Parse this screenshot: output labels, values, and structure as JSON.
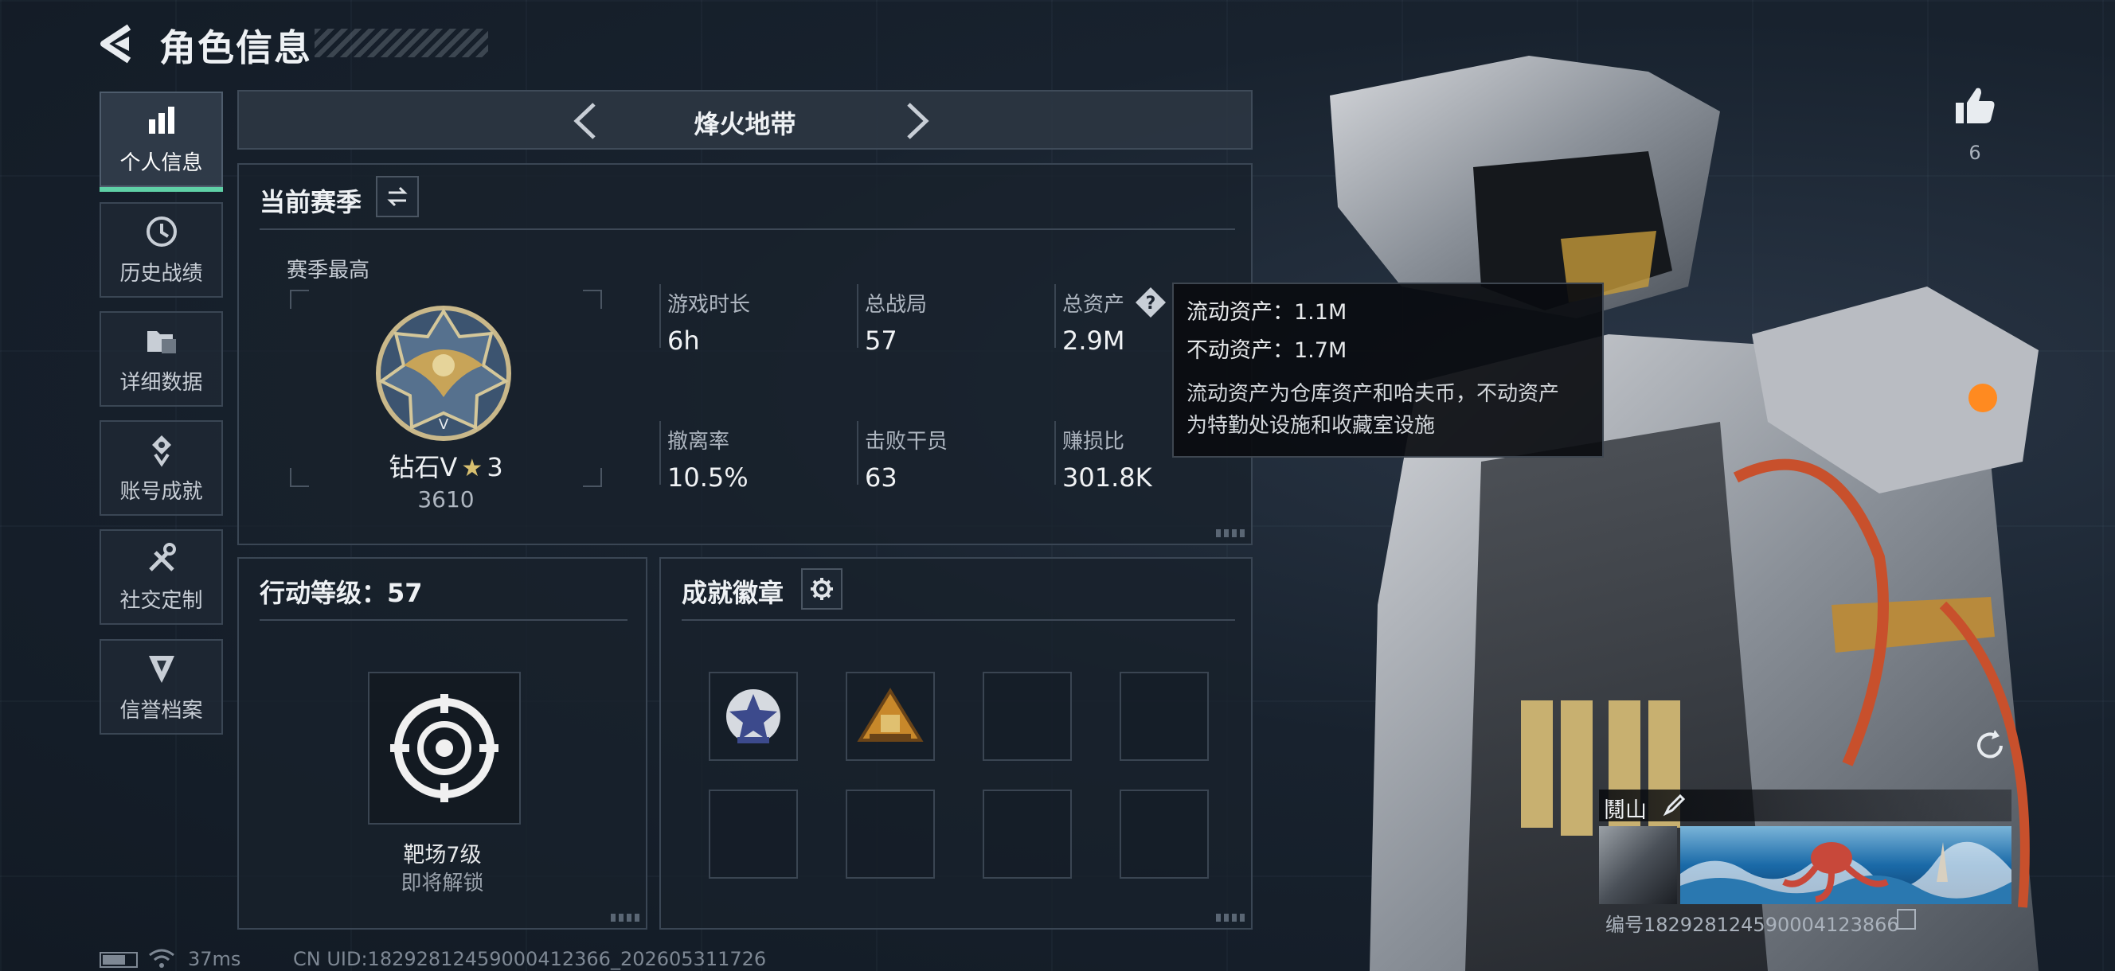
{
  "header": {
    "title": "角色信息"
  },
  "sidebar": {
    "items": [
      {
        "label": "个人信息",
        "icon": "bar-chart-icon",
        "active": true
      },
      {
        "label": "历史战绩",
        "icon": "clock-history-icon"
      },
      {
        "label": "详细数据",
        "icon": "folder-data-icon"
      },
      {
        "label": "账号成就",
        "icon": "achievement-medal-icon"
      },
      {
        "label": "社交定制",
        "icon": "tools-icon"
      },
      {
        "label": "信誉档案",
        "icon": "credit-shield-icon"
      }
    ]
  },
  "mode": {
    "title": "烽火地带"
  },
  "season": {
    "title": "当前赛季",
    "best_label": "赛季最高",
    "rank": "钻石Ⅴ",
    "stars": "3",
    "score": "3610",
    "stats": [
      {
        "label": "游戏时长",
        "value": "6h"
      },
      {
        "label": "总战局",
        "value": "57"
      },
      {
        "label": "总资产",
        "value": "2.9M"
      },
      {
        "label": "撤离率",
        "value": "10.5%"
      },
      {
        "label": "击败干员",
        "value": "63"
      },
      {
        "label": "赚损比",
        "value": "301.8K"
      }
    ]
  },
  "tooltip": {
    "liquid": "流动资产：1.1M",
    "fixed": "不动资产：1.7M",
    "desc_line1": "流动资产为仓库资产和哈夫币，不动资产",
    "desc_line2": "为特勤处设施和收藏室设施"
  },
  "action_level": {
    "title": "行动等级：57",
    "unlock_name": "靶场7级",
    "unlock_status": "即将解锁"
  },
  "achievements": {
    "title": "成就徽章"
  },
  "likes": {
    "count": "6"
  },
  "player": {
    "name": "鬩山",
    "id_text": "编号182928124590004123866"
  },
  "footer": {
    "ping": "37ms",
    "uid": "CN UID:18292812459000412366_202605311726"
  },
  "colors": {
    "accent": "#5fd0a6",
    "panel_border": "#3a4654",
    "background": "#141d28"
  }
}
